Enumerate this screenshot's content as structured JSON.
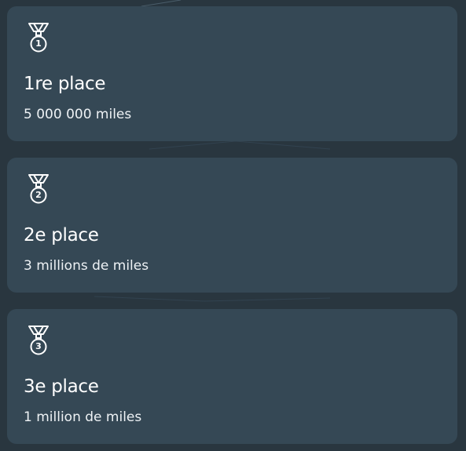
{
  "colors": {
    "background": "#29363f",
    "card": "#354855",
    "text": "#ffffff"
  },
  "rewards": [
    {
      "rank": "1",
      "title": "1re place",
      "prize": "5 000 000 miles",
      "icon": "medal-icon"
    },
    {
      "rank": "2",
      "title": "2e place",
      "prize": "3 millions de miles",
      "icon": "medal-icon"
    },
    {
      "rank": "3",
      "title": "3e place",
      "prize": "1 million de miles",
      "icon": "medal-icon"
    }
  ]
}
